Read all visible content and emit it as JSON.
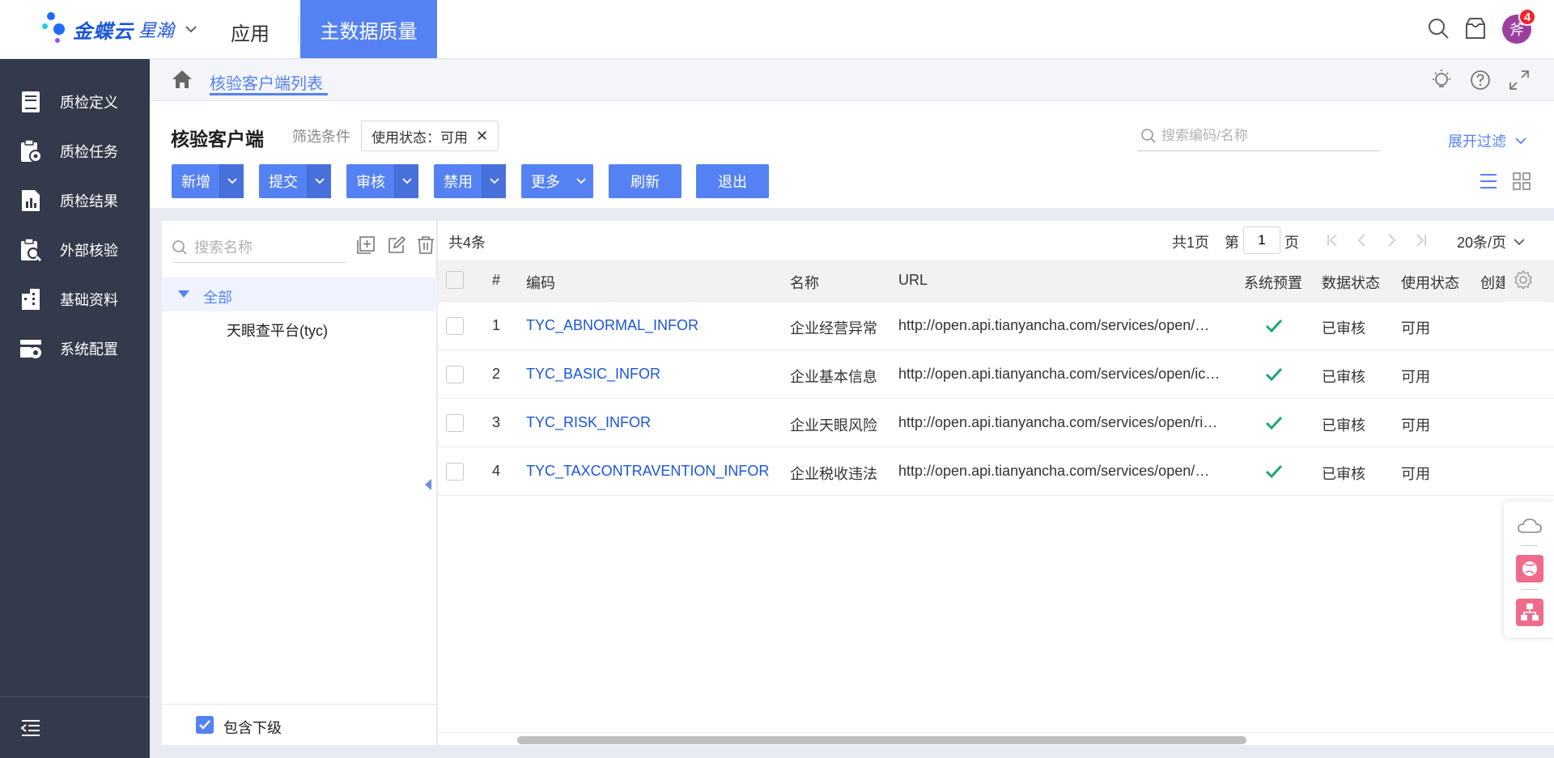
{
  "brand": {
    "name": "金蝶云",
    "product": "星瀚"
  },
  "topnav": {
    "app_label": "应用",
    "active_label": "主数据质量",
    "notification_count": "4",
    "avatar_text": "斧"
  },
  "sidebar": {
    "items": [
      {
        "label": "质检定义",
        "icon": "book-icon"
      },
      {
        "label": "质检任务",
        "icon": "task-icon"
      },
      {
        "label": "质检结果",
        "icon": "report-icon"
      },
      {
        "label": "外部核验",
        "icon": "clipboard-search-icon"
      },
      {
        "label": "基础资料",
        "icon": "building-icon"
      },
      {
        "label": "系统配置",
        "icon": "settings-box-icon"
      }
    ]
  },
  "breadcrumb": {
    "tab_label": "核验客户端列表"
  },
  "header": {
    "title": "核验客户端",
    "filter_label": "筛选条件",
    "filter_chip": "使用状态：可用",
    "search_placeholder": "搜索编码/名称",
    "expand_filter": "展开过滤"
  },
  "toolbar": {
    "buttons": [
      {
        "label": "新增"
      },
      {
        "label": "提交"
      },
      {
        "label": "审核"
      },
      {
        "label": "禁用"
      },
      {
        "label": "更多"
      },
      {
        "label": "刷新"
      },
      {
        "label": "退出"
      }
    ]
  },
  "tree": {
    "search_placeholder": "搜索名称",
    "root_label": "全部",
    "children": [
      "天眼查平台(tyc)"
    ],
    "include_children_label": "包含下级"
  },
  "grid": {
    "count_text": "共4条",
    "pager": {
      "total_pages": "共1页",
      "page_prefix": "第",
      "current_page": "1",
      "page_suffix": "页",
      "page_size": "20条/页"
    },
    "columns": [
      "#",
      "编码",
      "名称",
      "URL",
      "系统预置",
      "数据状态",
      "使用状态",
      "创建"
    ],
    "rows": [
      {
        "num": "1",
        "code": "TYC_ABNORMAL_INFOR",
        "name": "企业经营异常",
        "url": "http://open.api.tianyancha.com/services/open/m…",
        "preset": true,
        "data_status": "已审核",
        "use_status": "可用"
      },
      {
        "num": "2",
        "code": "TYC_BASIC_INFOR",
        "name": "企业基本信息",
        "url": "http://open.api.tianyancha.com/services/open/ic…",
        "preset": true,
        "data_status": "已审核",
        "use_status": "可用"
      },
      {
        "num": "3",
        "code": "TYC_RISK_INFOR",
        "name": "企业天眼风险",
        "url": "http://open.api.tianyancha.com/services/open/ri…",
        "preset": true,
        "data_status": "已审核",
        "use_status": "可用"
      },
      {
        "num": "4",
        "code": "TYC_TAXCONTRAVENTION_INFOR",
        "name": "企业税收违法",
        "url": "http://open.api.tianyancha.com/services/open/m…",
        "preset": true,
        "data_status": "已审核",
        "use_status": "可用"
      }
    ]
  },
  "colors": {
    "accent": "#5582f3",
    "sidebar_bg": "#333a4b",
    "link": "#1a56db",
    "check": "#1ea672",
    "badge": "#f5222d"
  }
}
